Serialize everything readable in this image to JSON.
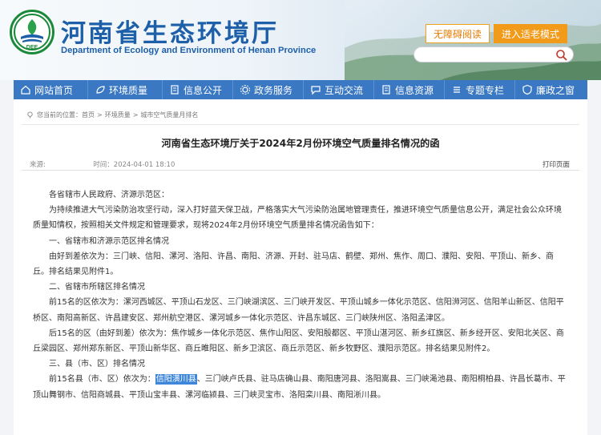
{
  "header": {
    "title": "河南省生态环境厅",
    "subtitle": "Department of Ecology and Environment of Henan Province",
    "logo_text": "DEE",
    "accessibility_btn": "无障碍阅读",
    "elder_mode_btn": "进入适老模式",
    "search_placeholder": ""
  },
  "nav": {
    "items": [
      {
        "label": "网站首页",
        "icon": "home-icon"
      },
      {
        "label": "环境质量",
        "icon": "leaf-icon"
      },
      {
        "label": "信息公开",
        "icon": "document-icon"
      },
      {
        "label": "政务服务",
        "icon": "gear-icon"
      },
      {
        "label": "互动交流",
        "icon": "chat-icon"
      },
      {
        "label": "信息资源",
        "icon": "document-icon"
      },
      {
        "label": "专题专栏",
        "icon": "list-icon"
      },
      {
        "label": "廉政之窗",
        "icon": "shield-icon"
      }
    ]
  },
  "breadcrumb": {
    "prefix": "您当前的位置：",
    "items": [
      "首页",
      "环境质量",
      "城市空气质量月排名"
    ],
    "sep": ">"
  },
  "article": {
    "title": "河南省生态环境厅关于2024年2月份环境空气质量排名情况的函",
    "source_label": "来源:",
    "time_label": "时间：2024-04-01 18:10",
    "print_label": "打印页面",
    "paragraphs": {
      "p1": "各省辖市人民政府、济源示范区：",
      "p2": "为持续推进大气污染防治攻坚行动，深入打好蓝天保卫战，严格落实大气污染防治属地管理责任，推进环境空气质量信息公开，满足社会公众环境质量知情权，按照相关文件规定和管理要求，现将2024年2月份环境空气质量排名情况函告如下：",
      "p3": "一、省辖市和济源示范区排名情况",
      "p4": "由好到差依次为：三门峡、信阳、漯河、洛阳、许昌、南阳、济源、开封、驻马店、鹤壁、郑州、焦作、周口、濮阳、安阳、平顶山、新乡、商丘。排名结果见附件1。",
      "p5": "二、省辖市所辖区排名情况",
      "p6": "前15名的区依次为：漯河西城区、平顶山石龙区、三门峡湖滨区、三门峡开发区、平顶山城乡一体化示范区、信阳浉河区、信阳羊山新区、信阳平桥区、南阳高新区、许昌建安区、郑州航空港区、漯河城乡一体化示范区、许昌东城区、三门峡陕州区、洛阳孟津区。",
      "p7": "后15名的区（由好到差）依次为：焦作城乡一体化示范区、焦作山阳区、安阳殷都区、平顶山湛河区、新乡红旗区、新乡经开区、安阳北关区、商丘梁园区、郑州郑东新区、平顶山新华区、商丘睢阳区、新乡卫滨区、商丘示范区、新乡牧野区、濮阳示范区。排名结果见附件2。",
      "p8": "三、县（市、区）排名情况",
      "p9_prefix": "前15名县（市、区）依次为：",
      "p9_highlight": "信阳潢川县",
      "p9_rest": "、三门峡卢氏县、驻马店确山县、南阳唐河县、洛阳嵩县、三门峡渑池县、南阳桐柏县、许昌长葛市、平顶山舞钢市、信阳商城县、平顶山宝丰县、漯河临颍县、三门峡灵宝市、洛阳栾川县、南阳淅川县。"
    }
  },
  "colors": {
    "brand_blue": "#1d5fa8",
    "nav_blue": "#3a78c3",
    "accent_orange": "#f29a1a",
    "logo_green": "#1a8a3a",
    "highlight": "#3d86d9"
  }
}
